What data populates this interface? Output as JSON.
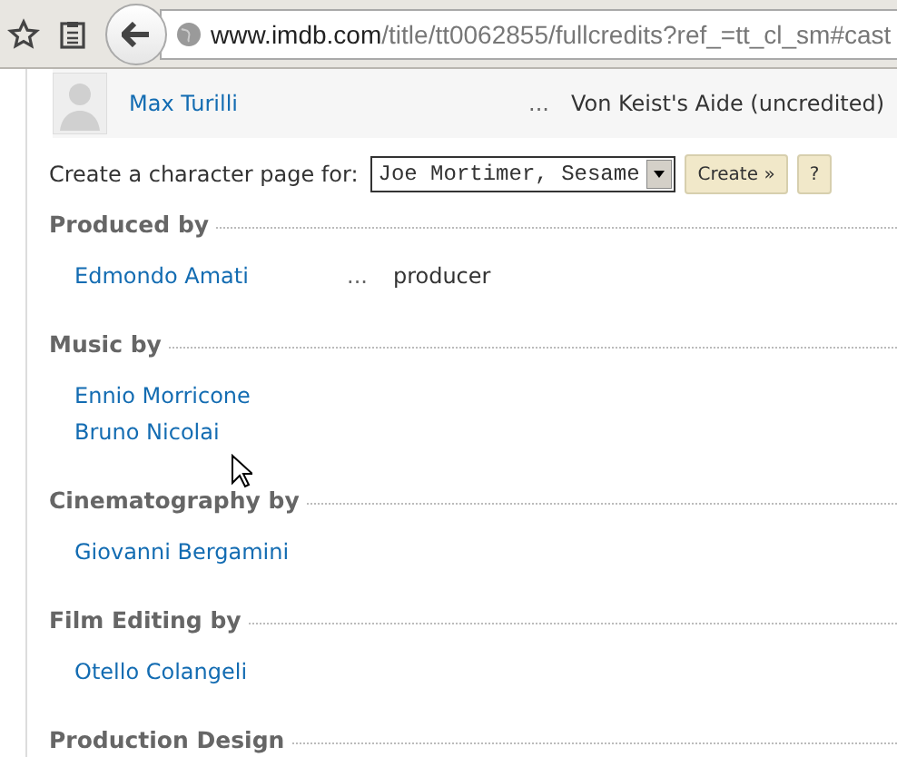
{
  "browser": {
    "url_host": "www.imdb.com",
    "url_path": "/title/tt0062855/fullcredits?ref_=tt_cl_sm#cast"
  },
  "cast_row": {
    "name": "Max Turilli",
    "dots": "...",
    "role": "Von Keist's Aide (uncredited)"
  },
  "character_page": {
    "label": "Create a character page for:",
    "select_value": "Joe Mortimer, Sesame",
    "create_button": "Create »",
    "help_button": "?"
  },
  "sections": [
    {
      "heading": "Produced by",
      "people": [
        {
          "name": "Edmondo Amati",
          "dots": "...",
          "credit": "producer"
        }
      ]
    },
    {
      "heading": "Music by",
      "people": [
        {
          "name": "Ennio Morricone"
        },
        {
          "name": "Bruno Nicolai"
        }
      ]
    },
    {
      "heading": "Cinematography by",
      "people": [
        {
          "name": "Giovanni Bergamini"
        }
      ]
    },
    {
      "heading": "Film Editing by",
      "people": [
        {
          "name": "Otello Colangeli"
        }
      ]
    },
    {
      "heading": "Production Design"
    }
  ]
}
